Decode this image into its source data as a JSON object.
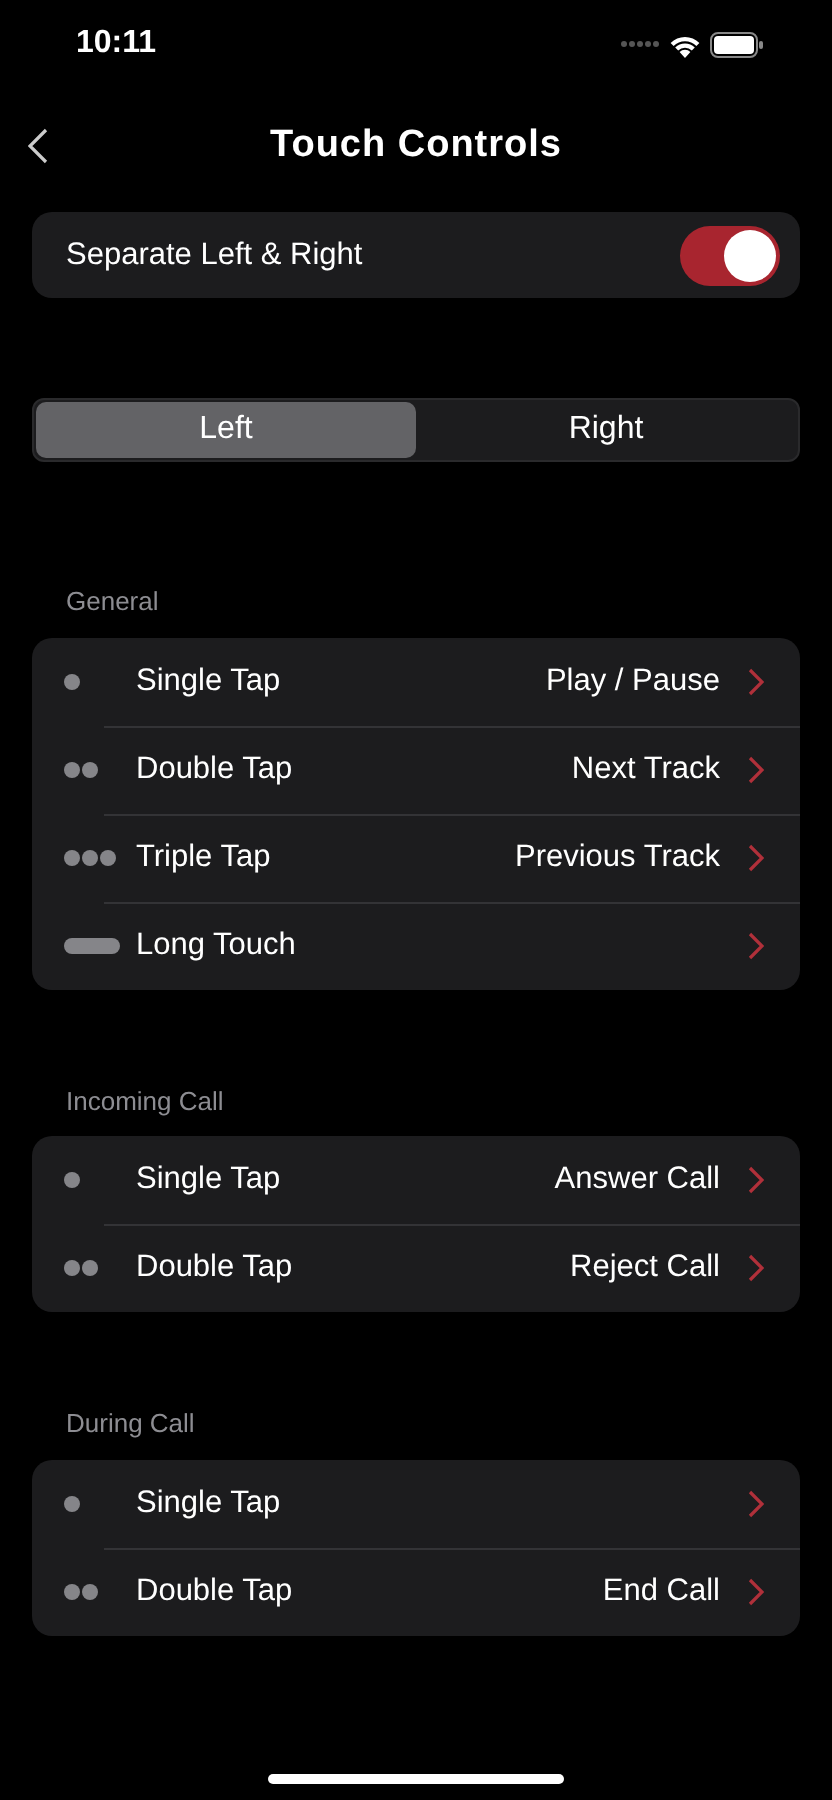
{
  "status_bar": {
    "time": "10:11"
  },
  "nav": {
    "title": "Touch Controls"
  },
  "separate_toggle": {
    "label": "Separate Left & Right",
    "on": true
  },
  "segments": [
    {
      "label": "Left",
      "selected": true
    },
    {
      "label": "Right",
      "selected": false
    }
  ],
  "sections": [
    {
      "title": "General",
      "rows": [
        {
          "kind": "single",
          "label": "Single Tap",
          "value": "Play / Pause"
        },
        {
          "kind": "double",
          "label": "Double Tap",
          "value": "Next Track"
        },
        {
          "kind": "triple",
          "label": "Triple Tap",
          "value": "Previous Track"
        },
        {
          "kind": "long",
          "label": "Long Touch"
        }
      ]
    },
    {
      "title": "Incoming Call",
      "rows": [
        {
          "kind": "single",
          "label": "Single Tap",
          "value": "Answer Call"
        },
        {
          "kind": "double",
          "label": "Double Tap",
          "value": "Reject Call"
        }
      ]
    },
    {
      "title": "During Call",
      "rows": [
        {
          "kind": "single",
          "label": "Single Tap"
        },
        {
          "kind": "double",
          "label": "Double Tap",
          "value": "End Call"
        }
      ]
    }
  ]
}
